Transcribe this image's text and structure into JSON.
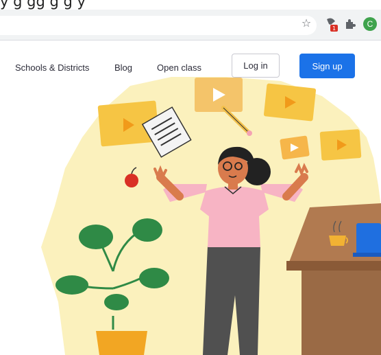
{
  "caption": {
    "text": "y                     g      gg  g      g   y"
  },
  "browser": {
    "bookmark_label": "☆",
    "extension_badge": "1",
    "profile_initial": "C"
  },
  "nav": {
    "links": [
      "Schools & Districts",
      "Blog",
      "Open class"
    ],
    "login_label": "Log in",
    "signup_label": "Sign up"
  },
  "colors": {
    "accent": "#1b72e8",
    "hero_blob": "#fbf1bd",
    "folder": "#f6c544",
    "shirt": "#f7b4c4",
    "pants": "#505050",
    "skin": "#d97b4d",
    "desk": "#9a6a45",
    "plant": "#2f8a46",
    "pot": "#f2a623"
  }
}
